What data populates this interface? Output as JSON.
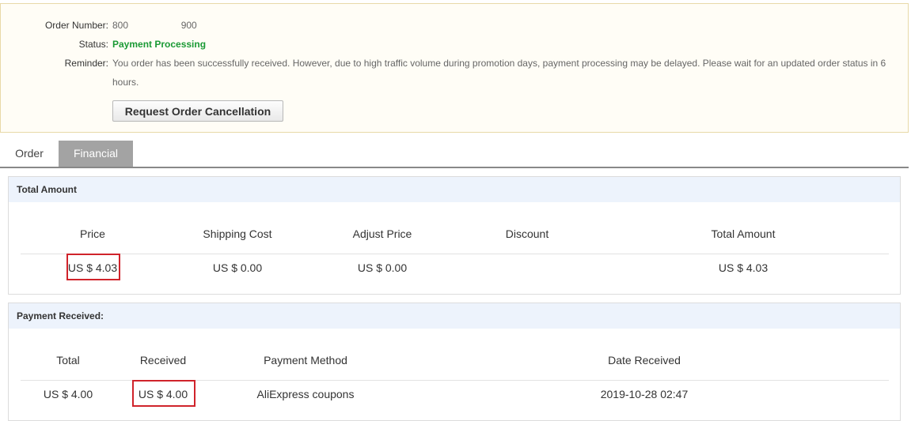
{
  "order": {
    "number_label": "Order Number:",
    "number_value": "800                    900",
    "status_label": "Status:",
    "status_value": "Payment Processing",
    "reminder_label": "Reminder:",
    "reminder_value": "You order has been successfully received. However, due to high traffic volume during promotion days, payment processing may be delayed. Please wait for an updated order status in 6 hours.",
    "cancel_button": "Request Order Cancellation",
    "status_color": "#1a9a35"
  },
  "tabs": [
    {
      "label": "Order",
      "active": false
    },
    {
      "label": "Financial",
      "active": true
    }
  ],
  "total_amount": {
    "title": "Total Amount",
    "headers": [
      "Price",
      "Shipping Cost",
      "Adjust Price",
      "Discount",
      "Total Amount"
    ],
    "values": [
      "US $ 4.03",
      "US $ 0.00",
      "US $ 0.00",
      "",
      "US $ 4.03"
    ]
  },
  "payment_received": {
    "title": "Payment Received:",
    "headers": [
      "Total",
      "Received",
      "Payment Method",
      "Date Received"
    ],
    "values": [
      "US $ 4.00",
      "US $ 4.00",
      "AliExpress coupons",
      "2019-10-28 02:47"
    ]
  },
  "highlight_color": "#d0232b"
}
